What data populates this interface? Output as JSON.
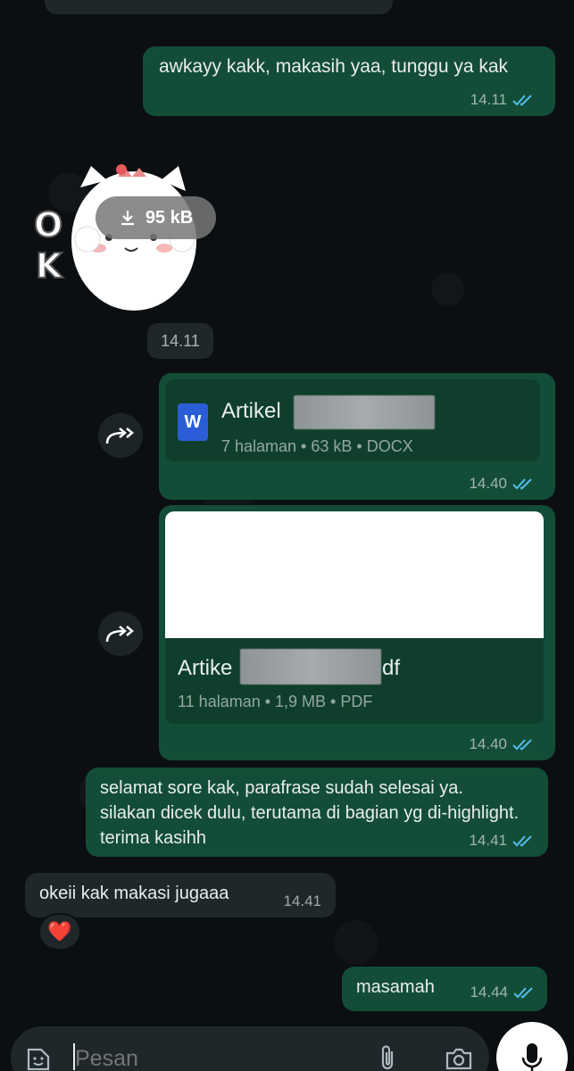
{
  "messages": {
    "m1": {
      "text": "awkayy kakk, makasih yaa, tunggu ya kak",
      "time": "14.11"
    },
    "sticker": {
      "size_label": "95 kB",
      "letter_o": "O",
      "letter_k": "K"
    },
    "date_chip": "14.11",
    "doc1": {
      "title": "Artikel",
      "meta": "7 halaman • 63 kB • DOCX",
      "icon_letter": "W",
      "time": "14.40"
    },
    "doc2": {
      "title_start": "Artike",
      "title_end": "df",
      "meta": "11 halaman • 1,9 MB • PDF",
      "time": "14.40"
    },
    "m2": {
      "text": "selamat sore kak, parafrase sudah selesai ya. silakan dicek dulu, terutama di bagian yg di-highlight. terima kasihh",
      "time": "14.41"
    },
    "m3": {
      "text": "okeii kak makasi jugaaa",
      "time": "14.41",
      "reaction": "❤️"
    },
    "m4": {
      "text": "masamah",
      "time": "14.44"
    }
  },
  "input": {
    "placeholder": "Pesan"
  },
  "colors": {
    "outgoing": "#134d37",
    "incoming": "#1f272a",
    "tick_blue": "#53bdeb"
  }
}
